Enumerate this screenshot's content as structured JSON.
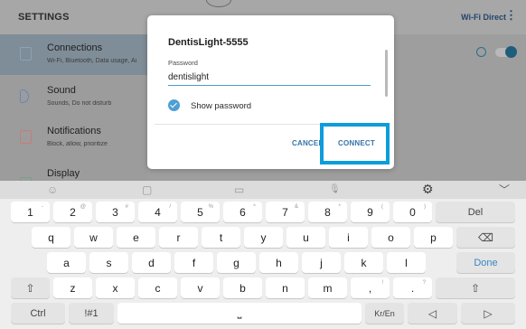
{
  "settings": {
    "title": "SETTINGS",
    "wifi_direct": "Wi-Fi Direct",
    "more_icon": "⋮",
    "sidebar": [
      {
        "label": "Connections",
        "sub": "Wi-Fi, Bluetooth, Data usage, Ai",
        "icon": "connections-icon"
      },
      {
        "label": "Sound",
        "sub": "Sounds, Do not disturb",
        "icon": "sound-icon"
      },
      {
        "label": "Notifications",
        "sub": "Block, allow, prioritize",
        "icon": "notifications-icon"
      },
      {
        "label": "Display",
        "sub": "",
        "icon": "display-icon"
      }
    ]
  },
  "dialog": {
    "network_name": "DentisLight-5555",
    "password_label": "Password",
    "password_value": "dentislight",
    "show_password_label": "Show password",
    "show_password_checked": true,
    "cancel_label": "CANCEL",
    "connect_label": "CONNECT"
  },
  "keyboard": {
    "toolbar": {
      "emoji": "☺",
      "sticker": "▢",
      "gif": "▭",
      "mic": "🎙",
      "settings": "⚙",
      "collapse": "﹀"
    },
    "rows": [
      [
        {
          "main": "1",
          "sup": "-"
        },
        {
          "main": "2",
          "sup": "@"
        },
        {
          "main": "3",
          "sup": "#"
        },
        {
          "main": "4",
          "sup": "/"
        },
        {
          "main": "5",
          "sup": "%"
        },
        {
          "main": "6",
          "sup": "^"
        },
        {
          "main": "7",
          "sup": "&"
        },
        {
          "main": "8",
          "sup": "*"
        },
        {
          "main": "9",
          "sup": "("
        },
        {
          "main": "0",
          "sup": ")"
        },
        {
          "main": "Del",
          "sup": ""
        }
      ],
      [
        {
          "main": "q"
        },
        {
          "main": "w"
        },
        {
          "main": "e"
        },
        {
          "main": "r"
        },
        {
          "main": "t"
        },
        {
          "main": "y"
        },
        {
          "main": "u"
        },
        {
          "main": "i"
        },
        {
          "main": "o"
        },
        {
          "main": "p"
        },
        {
          "main": "⌫"
        }
      ],
      [
        {
          "main": "a"
        },
        {
          "main": "s"
        },
        {
          "main": "d"
        },
        {
          "main": "f"
        },
        {
          "main": "g"
        },
        {
          "main": "h"
        },
        {
          "main": "j"
        },
        {
          "main": "k"
        },
        {
          "main": "l"
        },
        {
          "main": "Done"
        }
      ],
      [
        {
          "main": "⇧"
        },
        {
          "main": "z"
        },
        {
          "main": "x"
        },
        {
          "main": "c"
        },
        {
          "main": "v"
        },
        {
          "main": "b"
        },
        {
          "main": "n"
        },
        {
          "main": "m"
        },
        {
          "main": ",",
          "sup": "!"
        },
        {
          "main": ".",
          "sup": "?"
        },
        {
          "main": "⇧"
        }
      ],
      [
        {
          "main": "Ctrl"
        },
        {
          "main": "!#1"
        },
        {
          "main": "⎵"
        },
        {
          "main": "Kr/En"
        },
        {
          "main": "◁"
        },
        {
          "main": "▷"
        }
      ]
    ]
  },
  "colors": {
    "accent": "#0d9ddb",
    "link": "#3574a8",
    "checkbox": "#4e9fd3"
  }
}
